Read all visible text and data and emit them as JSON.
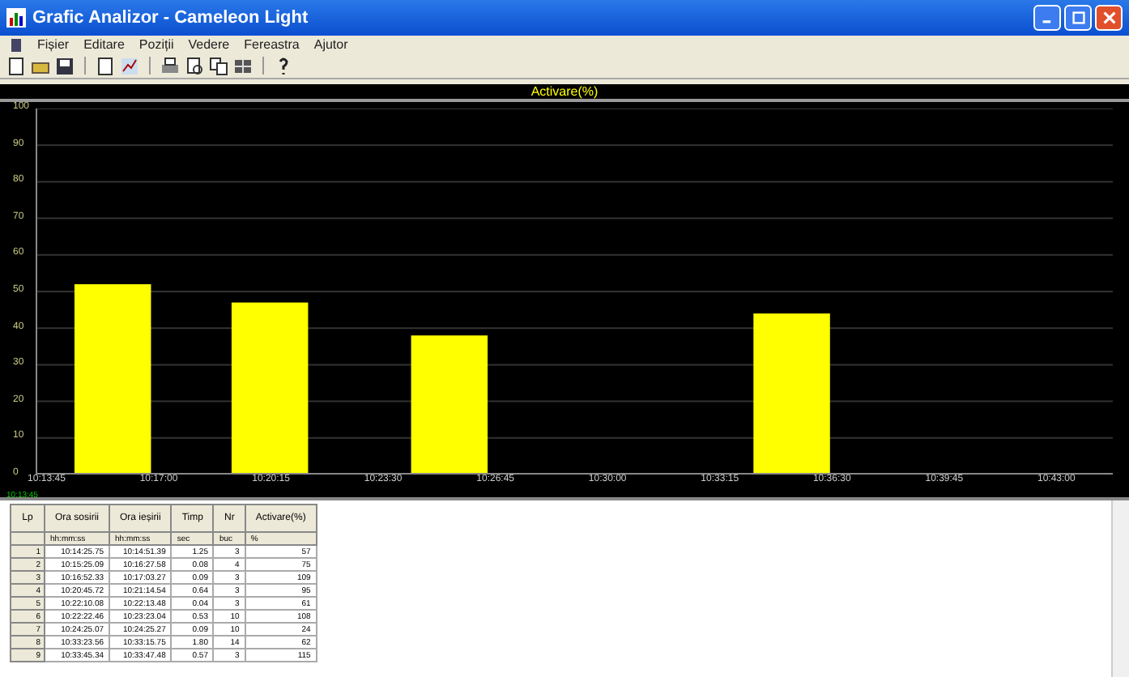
{
  "window": {
    "title": "Grafic Analizor - Cameleon Light"
  },
  "menu": [
    "Fișier",
    "Editare",
    "Poziții",
    "Vedere",
    "Fereastra",
    "Ajutor"
  ],
  "toolbar": [
    {
      "kind": "new"
    },
    {
      "kind": "open"
    },
    {
      "kind": "save"
    },
    {
      "kind": "sep"
    },
    {
      "kind": "doc"
    },
    {
      "kind": "chart"
    },
    {
      "kind": "sep"
    },
    {
      "kind": "print"
    },
    {
      "kind": "preview"
    },
    {
      "kind": "copy"
    },
    {
      "kind": "grid"
    },
    {
      "kind": "sep"
    },
    {
      "kind": "help"
    }
  ],
  "chart": {
    "chart_data": {
      "type": "bar",
      "title": "Activare(%)",
      "grid": true,
      "x": [
        36940,
        37213,
        37525,
        38120
      ],
      "series": [
        {
          "color": "#ffff00",
          "values": [
            52,
            47,
            38,
            44
          ]
        }
      ],
      "xlim": [
        36806,
        38678
      ],
      "ylim": [
        0,
        100
      ],
      "yticks": [
        0,
        10,
        20,
        30,
        40,
        50,
        60,
        70,
        80,
        90,
        100
      ],
      "xticks": [
        {
          "value": 36825,
          "label": "10:13:45"
        },
        {
          "value": 37020,
          "label": "10:17:00"
        },
        {
          "value": 37215,
          "label": "10:20:15"
        },
        {
          "value": 37410,
          "label": "10:23:30"
        },
        {
          "value": 37605,
          "label": "10:26:45"
        },
        {
          "value": 37800,
          "label": "10:30:00"
        },
        {
          "value": 37995,
          "label": "10:33:15"
        },
        {
          "value": 38190,
          "label": "10:36:30"
        },
        {
          "value": 38385,
          "label": "10:39:45"
        },
        {
          "value": 38580,
          "label": "10:43:00"
        }
      ]
    },
    "footer": "10:13:45"
  },
  "table": {
    "columns": [
      {
        "label": "Lp"
      },
      {
        "label": "Ora sosirii",
        "unit": "hh:mm:ss"
      },
      {
        "label": "Ora ieșirii",
        "unit": "hh:mm:ss"
      },
      {
        "label": "Timp",
        "unit": "sec"
      },
      {
        "label": "Nr",
        "unit": "buc"
      },
      {
        "label": "Activare(%)",
        "unit": "%"
      }
    ],
    "rows": [
      [
        "1",
        "10:14:25.75",
        "10:14:51.39",
        "1.25",
        "3",
        "57"
      ],
      [
        "2",
        "10:15:25.09",
        "10:16:27.58",
        "0.08",
        "4",
        "75"
      ],
      [
        "3",
        "10:16:52.33",
        "10:17:03.27",
        "0.09",
        "3",
        "109"
      ],
      [
        "4",
        "10:20:45.72",
        "10:21:14.54",
        "0.64",
        "3",
        "95"
      ],
      [
        "5",
        "10:22:10.08",
        "10:22:13.48",
        "0.04",
        "3",
        "61"
      ],
      [
        "6",
        "10:22:22.46",
        "10:23:23.04",
        "0.53",
        "10",
        "108"
      ],
      [
        "7",
        "10:24:25.07",
        "10:24:25.27",
        "0.09",
        "10",
        "24"
      ],
      [
        "8",
        "10:33:23.56",
        "10:33:15.75",
        "1.80",
        "14",
        "62"
      ],
      [
        "9",
        "10:33:45.34",
        "10:33:47.48",
        "0.57",
        "3",
        "115"
      ]
    ]
  }
}
